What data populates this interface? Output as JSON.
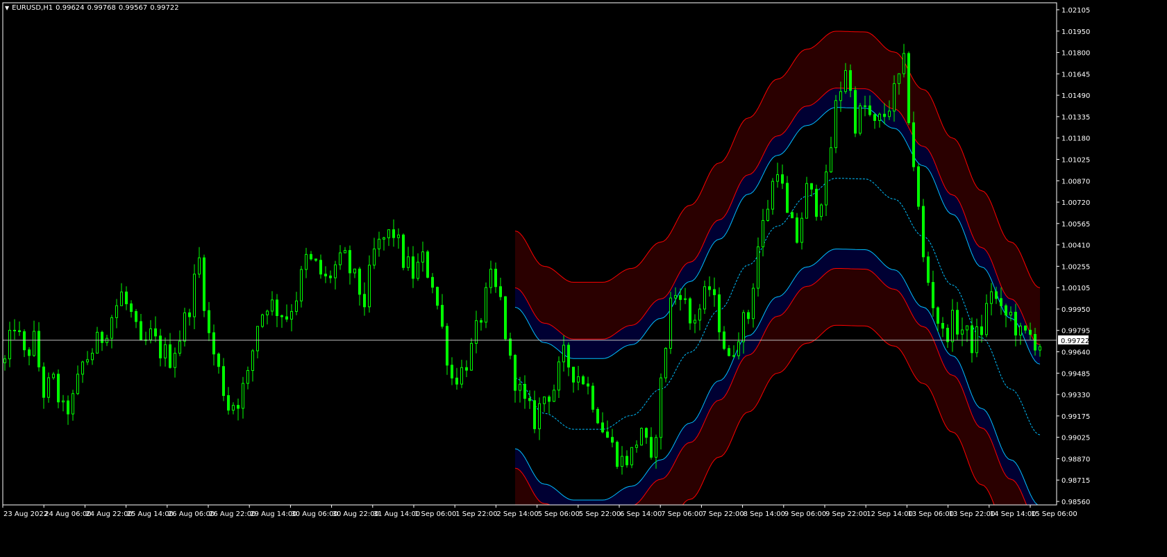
{
  "header": {
    "symbol": "EURUSD,H1",
    "open": "0.99624",
    "high": "0.99768",
    "low": "0.99567",
    "close": "0.99722"
  },
  "colors": {
    "background": "#000000",
    "frame": "#ffffff",
    "candle": "#00ff00",
    "band_fill_outer": "#2a0000",
    "band_fill_inner": "#000033",
    "band_line_red": "#ff0000",
    "band_line_cyan": "#00bfff",
    "price_line": "#c0c0c0",
    "text": "#ffffff"
  },
  "chart_data": {
    "type": "candlestick",
    "symbol": "EURUSD",
    "timeframe": "H1",
    "ylim": [
      0.9856,
      1.0215
    ],
    "y_ticks": [
      "1.02105",
      "1.01950",
      "1.01800",
      "1.01645",
      "1.01490",
      "1.01335",
      "1.01180",
      "1.01025",
      "1.00870",
      "1.00720",
      "1.00565",
      "1.00410",
      "1.00255",
      "1.00105",
      "0.99950",
      "0.99795",
      "0.99640",
      "0.99485",
      "0.99330",
      "0.99175",
      "0.99025",
      "0.98870",
      "0.98715",
      "0.98560"
    ],
    "current_price": "0.99722",
    "x_ticks": [
      "23 Aug 2022",
      "24 Aug 06:00",
      "24 Aug 22:00",
      "25 Aug 14:00",
      "26 Aug 06:00",
      "26 Aug 22:00",
      "29 Aug 14:00",
      "30 Aug 06:00",
      "30 Aug 22:00",
      "31 Aug 14:00",
      "1 Sep 06:00",
      "1 Sep 22:00",
      "2 Sep 14:00",
      "5 Sep 06:00",
      "5 Sep 22:00",
      "6 Sep 14:00",
      "7 Sep 06:00",
      "7 Sep 22:00",
      "8 Sep 14:00",
      "9 Sep 06:00",
      "9 Sep 22:00",
      "12 Sep 14:00",
      "13 Sep 06:00",
      "13 Sep 22:00",
      "14 Sep 14:00",
      "15 Sep 06:00"
    ],
    "close_path": [
      [
        0,
        0.9956
      ],
      [
        2,
        0.9985
      ],
      [
        4,
        0.996
      ],
      [
        6,
        0.9972
      ],
      [
        8,
        0.9935
      ],
      [
        10,
        0.9942
      ],
      [
        12,
        0.992
      ],
      [
        14,
        0.9928
      ],
      [
        16,
        0.9955
      ],
      [
        18,
        0.9965
      ],
      [
        20,
        0.9975
      ],
      [
        22,
        0.999
      ],
      [
        24,
        1.0005
      ],
      [
        26,
        0.999
      ],
      [
        28,
        0.9965
      ],
      [
        30,
        0.9975
      ],
      [
        32,
        0.9965
      ],
      [
        34,
        0.996
      ],
      [
        36,
        0.9975
      ],
      [
        38,
        0.9998
      ],
      [
        40,
        1.003
      ],
      [
        42,
        0.9975
      ],
      [
        44,
        0.995
      ],
      [
        46,
        0.9925
      ],
      [
        48,
        0.993
      ],
      [
        50,
        0.9945
      ],
      [
        52,
        0.9985
      ],
      [
        54,
        1.0
      ],
      [
        56,
        0.9995
      ],
      [
        58,
        0.999
      ],
      [
        60,
        1.0005
      ],
      [
        62,
        1.003
      ],
      [
        64,
        1.0025
      ],
      [
        66,
        1.0015
      ],
      [
        68,
        1.0025
      ],
      [
        70,
        1.003
      ],
      [
        72,
        1.0015
      ],
      [
        74,
        1.0
      ],
      [
        76,
        1.0035
      ],
      [
        78,
        1.0045
      ],
      [
        80,
        1.005
      ],
      [
        82,
        1.003
      ],
      [
        84,
        1.002
      ],
      [
        86,
        1.003
      ],
      [
        88,
        1.0015
      ],
      [
        90,
        0.998
      ],
      [
        92,
        0.9945
      ],
      [
        94,
        0.995
      ],
      [
        96,
        0.9965
      ],
      [
        98,
        0.999
      ],
      [
        100,
        1.0015
      ],
      [
        102,
        1.0
      ],
      [
        104,
        0.9955
      ],
      [
        105,
        0.9945
      ],
      [
        107,
        0.9925
      ],
      [
        109,
        0.9915
      ],
      [
        111,
        0.9932
      ],
      [
        113,
        0.9938
      ],
      [
        115,
        0.996
      ],
      [
        117,
        0.995
      ],
      [
        119,
        0.9945
      ],
      [
        121,
        0.993
      ],
      [
        123,
        0.991
      ],
      [
        125,
        0.9895
      ],
      [
        127,
        0.9885
      ],
      [
        129,
        0.989
      ],
      [
        131,
        0.991
      ],
      [
        133,
        0.988
      ],
      [
        135,
        0.994
      ],
      [
        137,
        1.0
      ],
      [
        139,
        1.001
      ],
      [
        141,
        0.9985
      ],
      [
        143,
        0.9995
      ],
      [
        145,
        1.001
      ],
      [
        147,
        0.9985
      ],
      [
        149,
        0.9955
      ],
      [
        151,
        0.998
      ],
      [
        153,
        0.999
      ],
      [
        155,
        1.004
      ],
      [
        157,
        1.007
      ],
      [
        159,
        1.01
      ],
      [
        161,
        1.006
      ],
      [
        163,
        1.0045
      ],
      [
        165,
        1.008
      ],
      [
        167,
        1.007
      ],
      [
        169,
        1.0085
      ],
      [
        171,
        1.014
      ],
      [
        173,
        1.017
      ],
      [
        175,
        1.013
      ],
      [
        177,
        1.014
      ],
      [
        179,
        1.0125
      ],
      [
        181,
        1.0135
      ],
      [
        183,
        1.015
      ],
      [
        185,
        1.017
      ],
      [
        187,
        1.01
      ],
      [
        189,
        1.003
      ],
      [
        191,
        1.0
      ],
      [
        193,
        0.9975
      ],
      [
        195,
        0.9985
      ],
      [
        197,
        0.998
      ],
      [
        199,
        0.997
      ],
      [
        201,
        0.998
      ],
      [
        203,
        1.001
      ],
      [
        205,
        0.999
      ],
      [
        207,
        0.999
      ],
      [
        209,
        0.9975
      ],
      [
        211,
        0.9975
      ],
      [
        213,
        0.997
      ]
    ],
    "regression_channel": {
      "start_bar": 105,
      "end_bar": 213,
      "center_points": [
        [
          105,
          0.9945
        ],
        [
          111,
          0.99195
        ],
        [
          117,
          0.9908
        ],
        [
          123,
          0.9908
        ],
        [
          129,
          0.9918
        ],
        [
          135,
          0.9937
        ],
        [
          141,
          0.99635
        ],
        [
          147,
          0.9994
        ],
        [
          153,
          1.00265
        ],
        [
          159,
          1.00545
        ],
        [
          165,
          1.0076
        ],
        [
          171,
          1.0089
        ],
        [
          177,
          1.00885
        ],
        [
          183,
          1.0074
        ],
        [
          189,
          1.0047
        ],
        [
          195,
          1.0012
        ],
        [
          201,
          0.9974
        ],
        [
          207,
          0.9937
        ],
        [
          213,
          0.9904
        ]
      ],
      "inner_offset": 0.0051,
      "red_offset": 0.0065,
      "outer_offset": 0.0106
    }
  }
}
